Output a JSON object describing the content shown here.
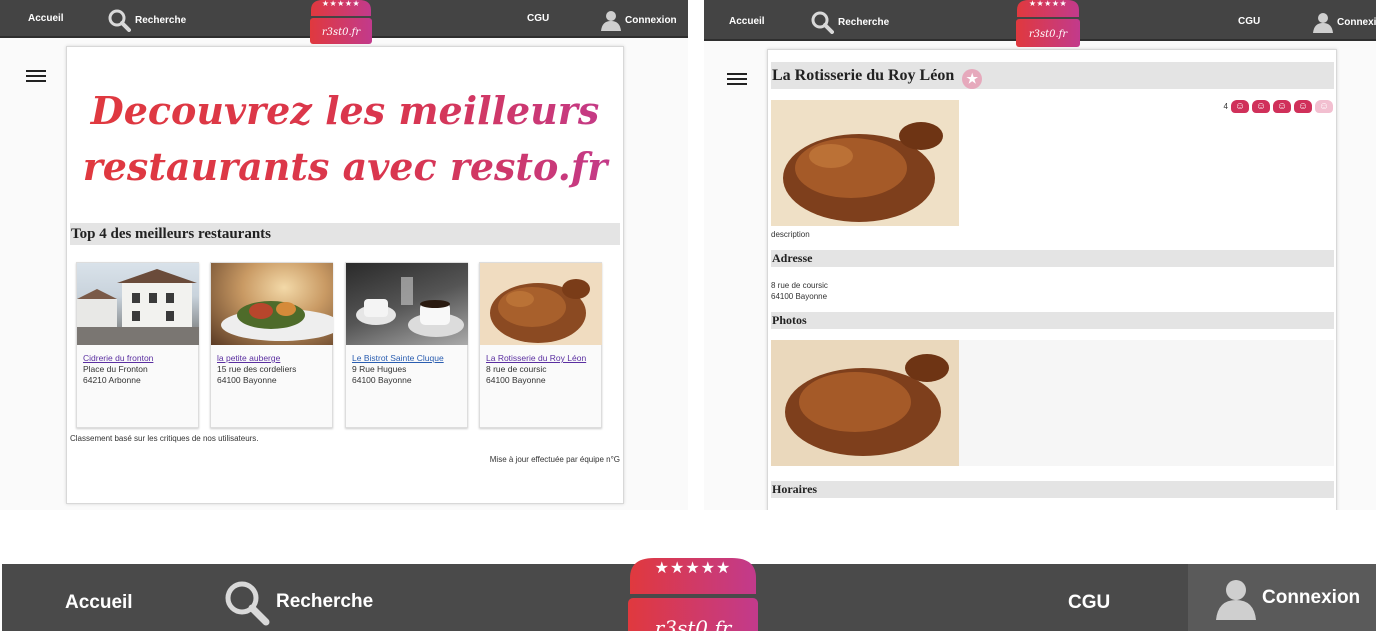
{
  "colors": {
    "navbar": "#444444",
    "accent_red": "#e0393e",
    "accent_pink": "#c23a8c",
    "link": "#5a2ea0",
    "link_blue": "#2a5db0",
    "section_bg": "#e4e4e4"
  },
  "nav": {
    "home": "Accueil",
    "search": "Recherche",
    "cgu": "CGU",
    "login": "Connexion",
    "logo_text": "r3st0.fr",
    "logo_stars": "★★★★★"
  },
  "home": {
    "hero_line1": "Decouvrez les meilleurs",
    "hero_line2": "restaurants avec resto.fr",
    "top_title": "Top 4 des meilleurs restaurants",
    "restaurants": [
      {
        "name": "Cidrerie du fronton",
        "street": "Place du Fronton",
        "city": "64210 Arbonne",
        "image": "house-photo"
      },
      {
        "name": "la petite auberge",
        "street": "15 rue des cordeliers",
        "city": "64100 Bayonne",
        "image": "food-plate-photo"
      },
      {
        "name": "Le Bistrot Sainte Cluque",
        "street": "9 Rue Hugues",
        "city": "64100 Bayonne",
        "image": "coffee-cups-photo"
      },
      {
        "name": "La Rotisserie du Roy Léon",
        "street": "8 rue de coursic",
        "city": "64100 Bayonne",
        "image": "roast-chicken-photo"
      }
    ],
    "ranking_note": "Classement basé sur les critiques de nos utilisateurs.",
    "update_note": "Mise à jour effectuée par équipe n°G"
  },
  "detail": {
    "title": "La Rotisserie du Roy Léon",
    "rating_value": "4",
    "rating_max": 5,
    "description": "description",
    "address_title": "Adresse",
    "address_line1": "8 rue de coursic",
    "address_line2": "64100 Bayonne",
    "photos_title": "Photos",
    "hours_title": "Horaires"
  }
}
